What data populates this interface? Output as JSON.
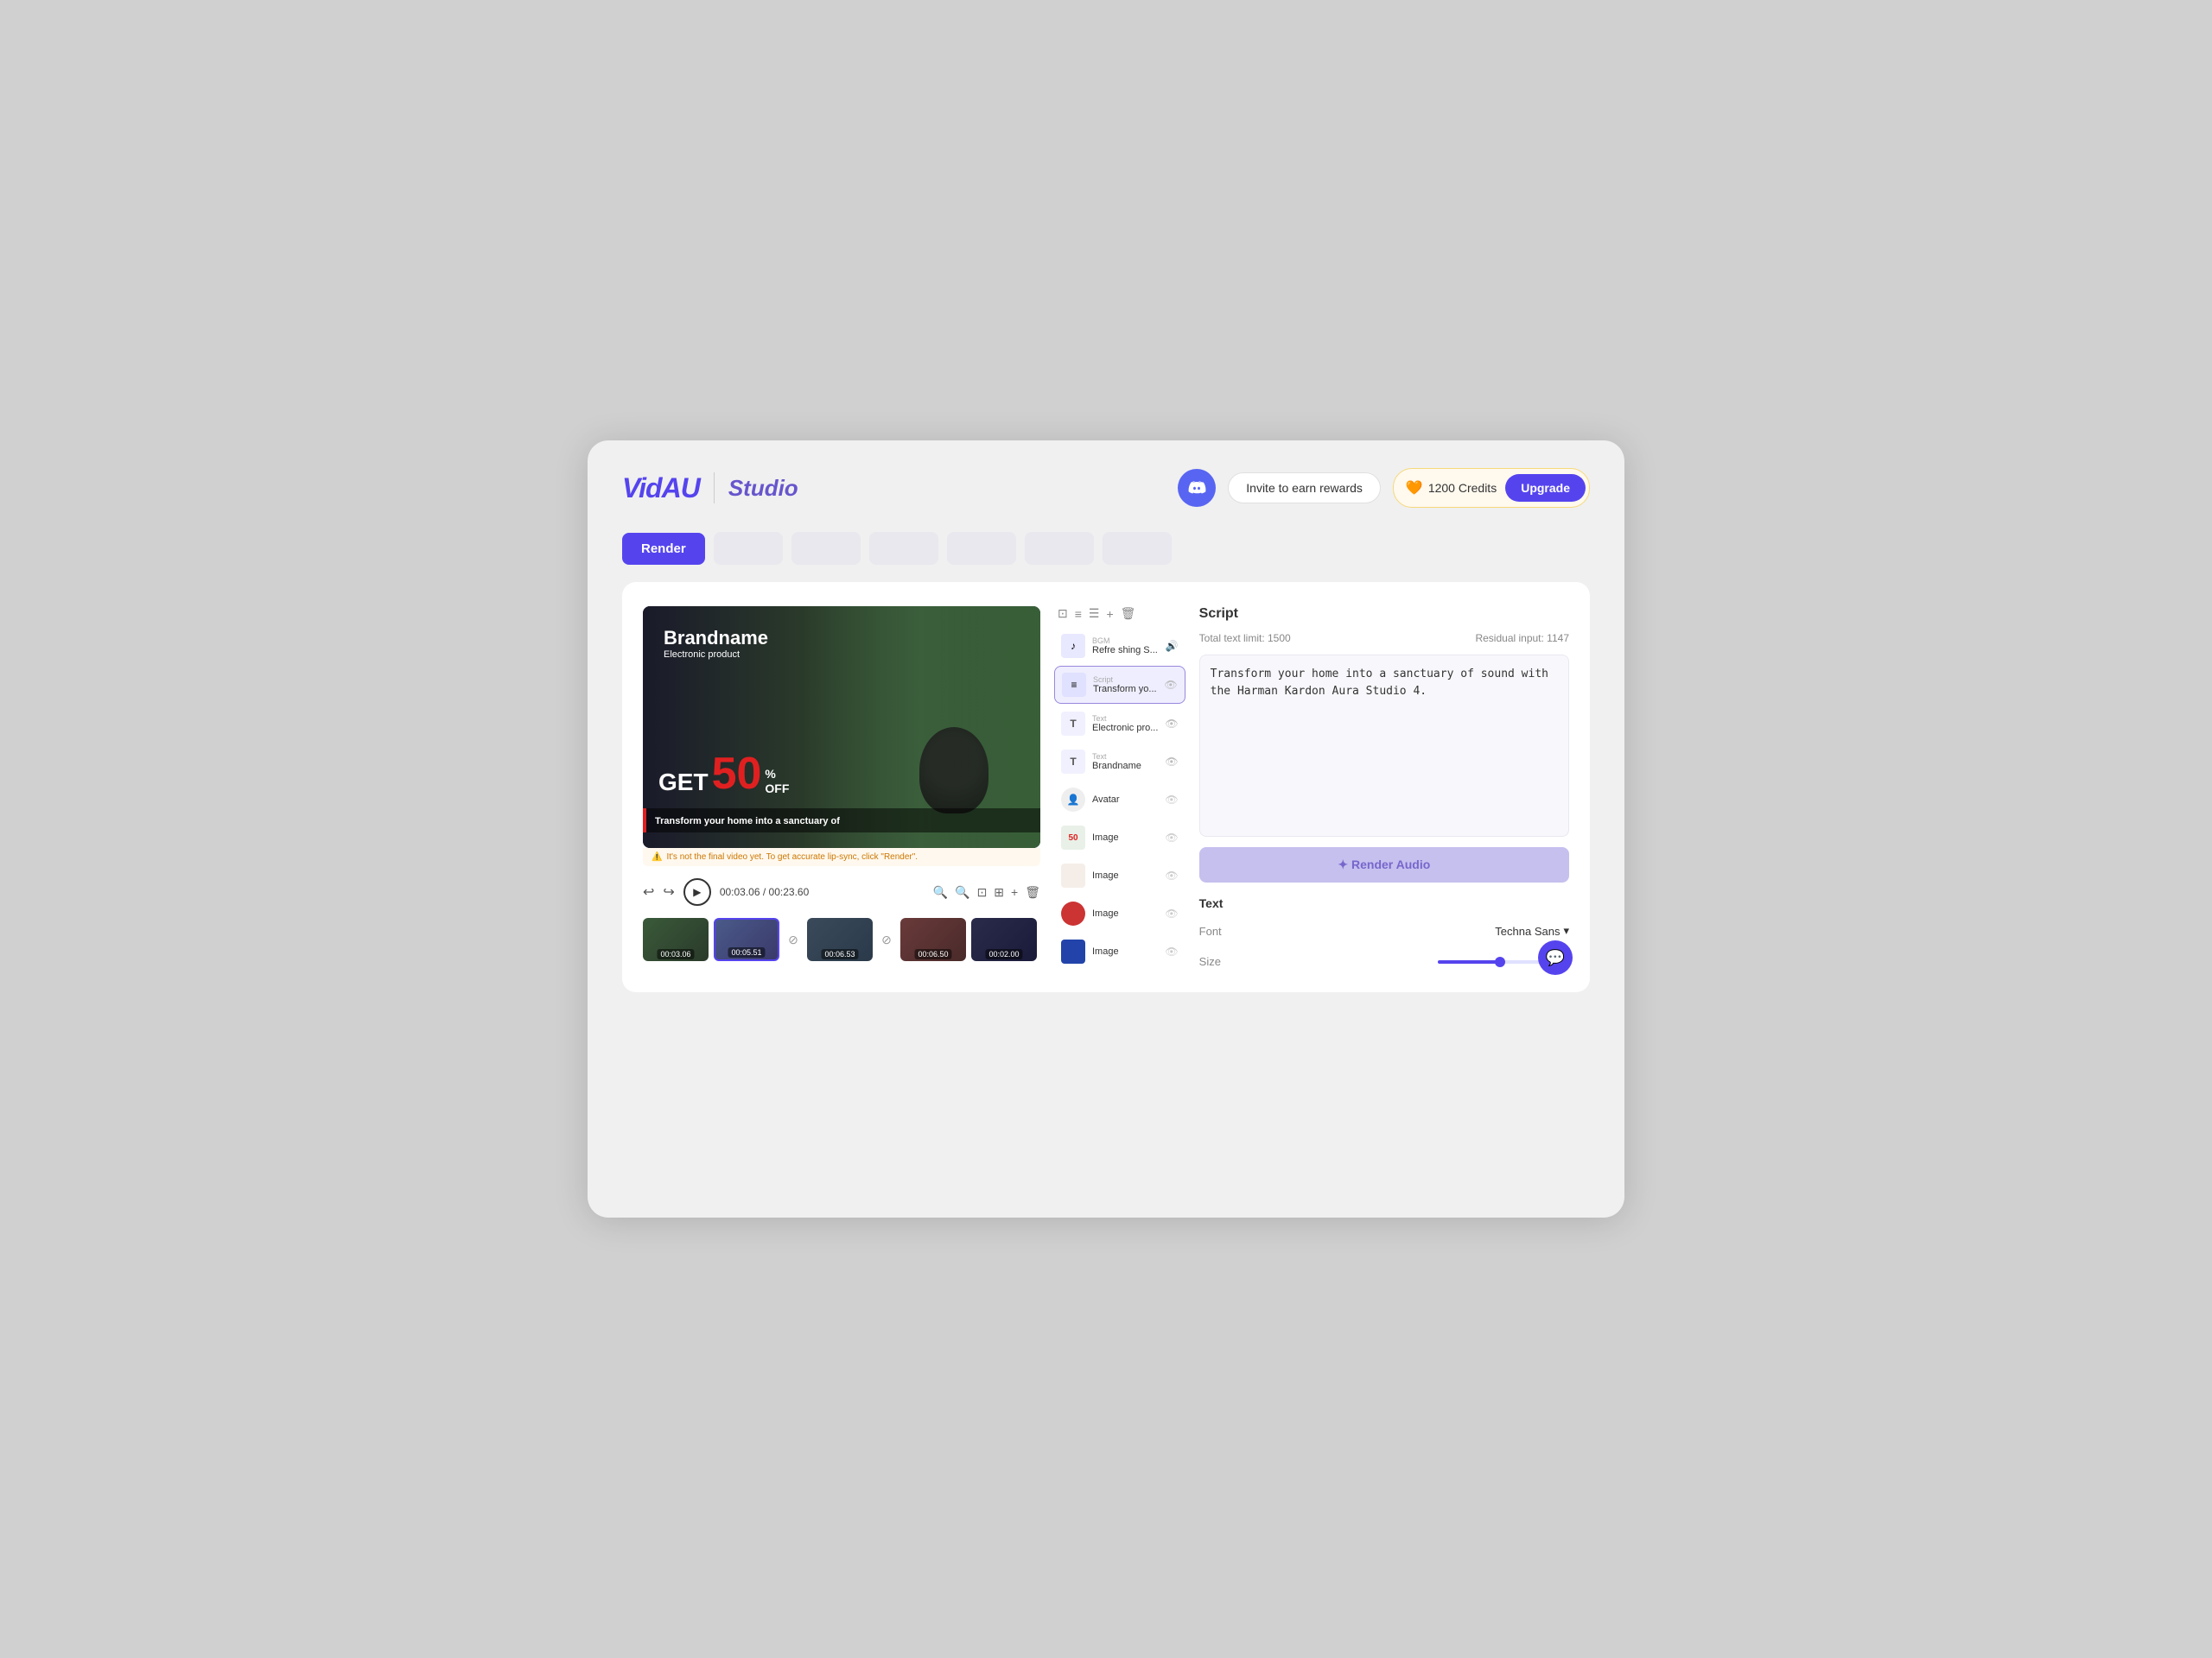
{
  "app": {
    "logo": "VidAU",
    "subtitle": "Studio"
  },
  "header": {
    "discord_label": "🎮",
    "invite_label": "Invite to earn rewards",
    "credits_label": "1200 Credits",
    "upgrade_label": "Upgrade"
  },
  "toolbar": {
    "render_label": "Render",
    "tabs": [
      "",
      "",
      "",
      "",
      "",
      ""
    ]
  },
  "video": {
    "brand_name": "Brandname",
    "product_sub": "Electronic product",
    "get_text": "GET",
    "fifty": "50",
    "percent": "%",
    "off": "OFF",
    "subtitle": "Transform your home into a sanctuary of",
    "warning": "It's not the final video yet. To get accurate lip-sync, click \"Render\".",
    "time_current": "00:03.06",
    "time_total": "00:23.60"
  },
  "thumbnails": [
    {
      "time": "00:03.06"
    },
    {
      "time": "00:05.51",
      "active": true
    },
    {
      "time": "00:06.53"
    },
    {
      "time": "00:06.50"
    },
    {
      "time": "00:02.00"
    }
  ],
  "layers": [
    {
      "type": "BGM",
      "name": "Refre shing S...",
      "icon": "♪",
      "eye": true
    },
    {
      "type": "Script",
      "name": "Transform yo...",
      "icon": "≡",
      "active": true,
      "eye": false
    },
    {
      "type": "Text",
      "name": "Electronic pro...",
      "icon": "T",
      "eye": false
    },
    {
      "type": "Text",
      "name": "Brandname",
      "icon": "T",
      "eye": false
    },
    {
      "type": "Avatar",
      "name": "Avatar",
      "icon": "👤",
      "eye": true
    },
    {
      "type": "",
      "name": "Image",
      "icon": "50",
      "eye": false
    },
    {
      "type": "",
      "name": "Image",
      "icon": "🖼",
      "eye": false
    },
    {
      "type": "",
      "name": "Image",
      "icon": "🎨",
      "eye": false
    },
    {
      "type": "",
      "name": "Image",
      "icon": "📷",
      "eye": false
    }
  ],
  "script": {
    "header": "Script",
    "total_text_limit_label": "Total text limit: 1500",
    "residual_input_label": "Residual input: 1147",
    "content": "Transform your home into a sanctuary of sound with the Harman Kardon Aura Studio 4.",
    "render_audio_label": "✦ Render Audio"
  },
  "text_props": {
    "header": "Text",
    "font_label": "Font",
    "font_value": "Techna Sans",
    "size_label": "Size",
    "size_value": "35"
  },
  "colors": {
    "accent": "#5544ee",
    "brand": "#5544ee"
  }
}
